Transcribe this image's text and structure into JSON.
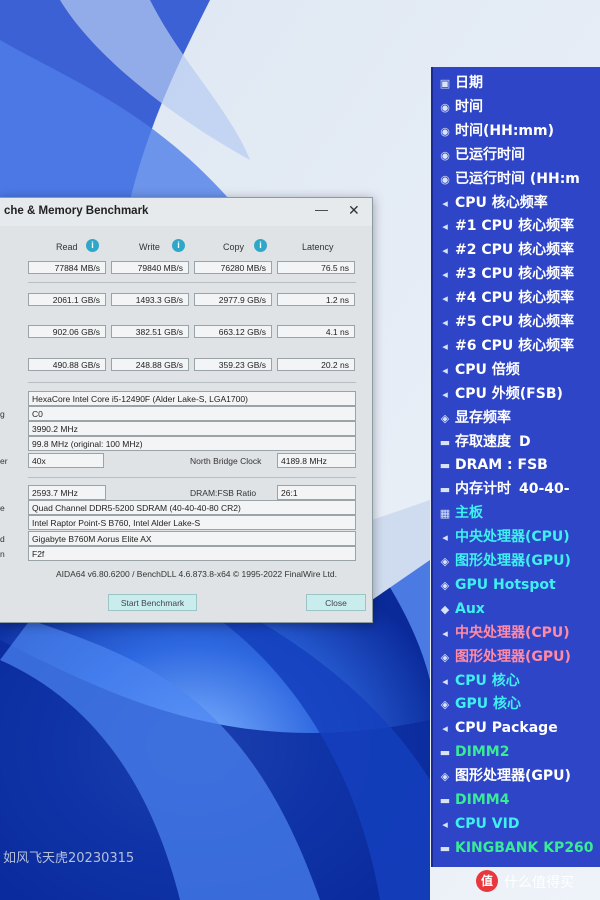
{
  "window": {
    "title": "che & Memory Benchmark",
    "minimize": "—",
    "close": "✕"
  },
  "columns": [
    "Read",
    "Write",
    "Copy",
    "Latency"
  ],
  "info_icon": "i",
  "results": [
    [
      "77884 MB/s",
      "79840 MB/s",
      "76280 MB/s",
      "76.5 ns"
    ],
    [
      "2061.1 GB/s",
      "1493.3 GB/s",
      "2977.9 GB/s",
      "1.2 ns"
    ],
    [
      "902.06 GB/s",
      "382.51 GB/s",
      "663.12 GB/s",
      "4.1 ns"
    ],
    [
      "490.88 GB/s",
      "248.88 GB/s",
      "359.23 GB/s",
      "20.2 ns"
    ]
  ],
  "cpu_info": {
    "cpu_type": "HexaCore Intel Core i5-12490F  (Alder Lake-S, LGA1700)",
    "cpu_stepping_label": "g",
    "cpu_stepping": "C0",
    "cpu_clock": "3990.2 MHz",
    "cpu_fsb": "99.8 MHz  (original: 100 MHz)",
    "multiplier_label": "er",
    "multiplier": "40x",
    "nb_clock_label": "North Bridge Clock",
    "nb_clock": "4189.8 MHz"
  },
  "mem_info": {
    "memory_bus": "2593.7 MHz",
    "dram_fsb_label": "DRAM:FSB Ratio",
    "dram_fsb": "26:1",
    "memory_type_label": "e",
    "memory_type": "Quad Channel DDR5-5200 SDRAM  (40-40-40-80 CR2)",
    "chipset": "Intel Raptor Point-S B760, Intel Alder Lake-S",
    "motherboard_label": "d",
    "motherboard": "Gigabyte B760M Aorus Elite AX",
    "bios_label": "n",
    "bios": "F2f"
  },
  "footer": {
    "version": "AIDA64 v6.80.6200 / BenchDLL 4.6.873.8-x64  © 1995-2022 FinalWire Ltd.",
    "start_button": "Start Benchmark",
    "close_button": "Close"
  },
  "sensor_panel": {
    "rows": [
      {
        "icon": "calendar-icon",
        "glyph": "▣",
        "text": "日期",
        "color": "white",
        "value": ""
      },
      {
        "icon": "clock-icon",
        "glyph": "◉",
        "text": "时间",
        "color": "white",
        "value": ""
      },
      {
        "icon": "clock-icon",
        "glyph": "◉",
        "text": "时间(HH:mm)",
        "color": "white",
        "value": ""
      },
      {
        "icon": "clock-icon",
        "glyph": "◉",
        "text": "已运行时间",
        "color": "white",
        "value": ""
      },
      {
        "icon": "clock-icon",
        "glyph": "◉",
        "text": "已运行时间 (HH:m",
        "color": "white",
        "value": ""
      },
      {
        "icon": "cpu-icon",
        "glyph": "◂",
        "text": "CPU 核心频率",
        "color": "white",
        "value": ""
      },
      {
        "icon": "cpu-icon",
        "glyph": "◂",
        "text": "#1 CPU 核心频率",
        "color": "white",
        "value": ""
      },
      {
        "icon": "cpu-icon",
        "glyph": "◂",
        "text": "#2 CPU 核心频率",
        "color": "white",
        "value": ""
      },
      {
        "icon": "cpu-icon",
        "glyph": "◂",
        "text": "#3 CPU 核心频率",
        "color": "white",
        "value": ""
      },
      {
        "icon": "cpu-icon",
        "glyph": "◂",
        "text": "#4 CPU 核心频率",
        "color": "white",
        "value": ""
      },
      {
        "icon": "cpu-icon",
        "glyph": "◂",
        "text": "#5 CPU 核心频率",
        "color": "white",
        "value": ""
      },
      {
        "icon": "cpu-icon",
        "glyph": "◂",
        "text": "#6 CPU 核心频率",
        "color": "white",
        "value": ""
      },
      {
        "icon": "cpu-icon",
        "glyph": "◂",
        "text": "CPU 倍频",
        "color": "white",
        "value": ""
      },
      {
        "icon": "cpu-icon",
        "glyph": "◂",
        "text": "CPU 外频(FSB)",
        "color": "white",
        "value": ""
      },
      {
        "icon": "gpu-icon",
        "glyph": "◈",
        "text": "显存频率",
        "color": "white",
        "value": ""
      },
      {
        "icon": "memory-icon",
        "glyph": "▬",
        "text": "存取速度",
        "color": "white",
        "value": "D"
      },
      {
        "icon": "memory-icon",
        "glyph": "▬",
        "text": "DRAM : FSB",
        "color": "white",
        "value": ""
      },
      {
        "icon": "memory-icon",
        "glyph": "▬",
        "text": "内存计时",
        "color": "white",
        "value": "40-40-"
      },
      {
        "icon": "motherboard-icon",
        "glyph": "▦",
        "text": "主板",
        "color": "cyan",
        "value": ""
      },
      {
        "icon": "cpu-icon",
        "glyph": "◂",
        "text": "中央处理器(CPU)",
        "color": "cyan",
        "value": ""
      },
      {
        "icon": "gpu-icon",
        "glyph": "◈",
        "text": "图形处理器(GPU)",
        "color": "cyan",
        "value": ""
      },
      {
        "icon": "gpu-icon",
        "glyph": "◈",
        "text": "GPU Hotspot",
        "color": "cyan",
        "value": ""
      },
      {
        "icon": "sensor-icon",
        "glyph": "◆",
        "text": "Aux",
        "color": "cyan",
        "value": ""
      },
      {
        "icon": "cpu-icon",
        "glyph": "◂",
        "text": "中央处理器(CPU)",
        "color": "pink",
        "value": ""
      },
      {
        "icon": "gpu-icon",
        "glyph": "◈",
        "text": "图形处理器(GPU)",
        "color": "pink",
        "value": ""
      },
      {
        "icon": "cpu-icon",
        "glyph": "◂",
        "text": "CPU 核心",
        "color": "cyan",
        "value": ""
      },
      {
        "icon": "gpu-icon",
        "glyph": "◈",
        "text": "GPU 核心",
        "color": "cyan",
        "value": ""
      },
      {
        "icon": "cpu-icon",
        "glyph": "◂",
        "text": "CPU Package",
        "color": "white",
        "value": ""
      },
      {
        "icon": "memory-icon",
        "glyph": "▬",
        "text": "DIMM2",
        "color": "green",
        "value": ""
      },
      {
        "icon": "gpu-icon",
        "glyph": "◈",
        "text": "图形处理器(GPU)",
        "color": "white",
        "value": ""
      },
      {
        "icon": "memory-icon",
        "glyph": "▬",
        "text": "DIMM4",
        "color": "green",
        "value": ""
      },
      {
        "icon": "cpu-icon",
        "glyph": "◂",
        "text": "CPU VID",
        "color": "cyan",
        "value": ""
      },
      {
        "icon": "disk-icon",
        "glyph": "▬",
        "text": "KINGBANK KP260",
        "color": "green",
        "value": ""
      }
    ]
  },
  "watermark": "如风飞天虎20230315",
  "brand": {
    "logo": "值",
    "text": "什么值得买"
  },
  "colors": {
    "panel_bg": "#2f45c8",
    "cyan": "#3ef0ef",
    "green": "#39ea97",
    "pink": "#ff8aa5",
    "wallpaper_blue": "#1f5fd8"
  }
}
